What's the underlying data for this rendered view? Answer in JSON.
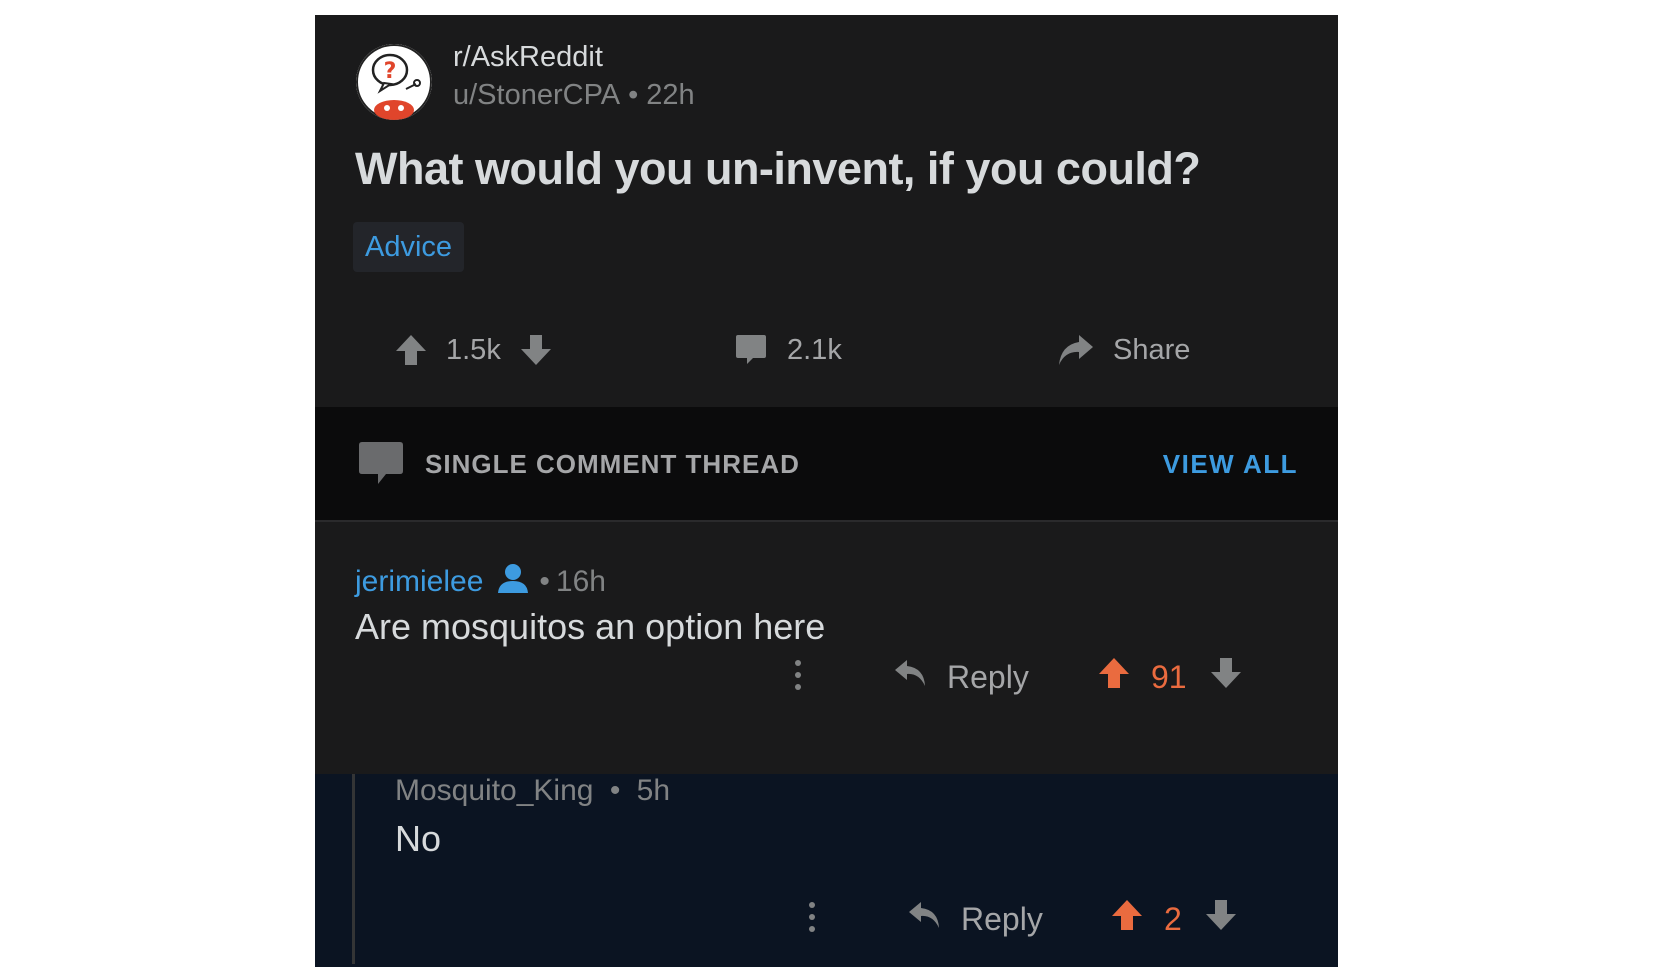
{
  "post": {
    "subreddit": "r/AskReddit",
    "author": "u/StonerCPA",
    "separator": "•",
    "age": "22h",
    "title": "What would you un-invent, if you could?",
    "flair": "Advice",
    "upvotes": "1.5k",
    "comments": "2.1k",
    "share_label": "Share"
  },
  "thread": {
    "label": "SINGLE COMMENT THREAD",
    "view_all": "VIEW ALL"
  },
  "comments": [
    {
      "author": "jerimielee",
      "separator": "•",
      "age": "16h",
      "body": "Are mosquitos an option here",
      "reply_label": "Reply",
      "score": "91"
    },
    {
      "author": "Mosquito_King",
      "separator": "•",
      "age": "5h",
      "body": "No",
      "reply_label": "Reply",
      "score": "2"
    }
  ],
  "colors": {
    "background": "#1a1a1b",
    "link_blue": "#3d9be0",
    "upvote_orange": "#ea6b3f",
    "reply_bg": "#0b1422"
  },
  "icons": {
    "subreddit_avatar": "askreddit-snoo-icon",
    "upvote": "arrow-up-icon",
    "downvote": "arrow-down-icon",
    "comments": "speech-bubble-icon",
    "share": "share-arrow-icon",
    "op_badge": "user-icon",
    "reply": "reply-arrow-icon",
    "more": "kebab-menu-icon"
  }
}
